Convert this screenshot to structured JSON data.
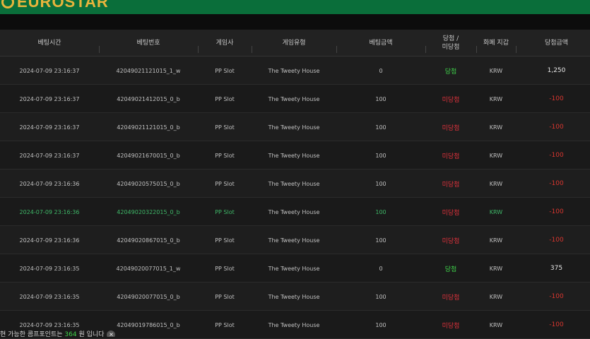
{
  "brand": {
    "logo_text": "EUROSTAR"
  },
  "nav": {
    "items": [
      "",
      "",
      "",
      "",
      "",
      "",
      "",
      "",
      "",
      ""
    ]
  },
  "table": {
    "headers": {
      "bet_time": "베팅시간",
      "bet_no": "베팅번호",
      "provider": "게임사",
      "game_type": "게임유형",
      "bet_amount": "베팅금액",
      "result_top": "당첨 /",
      "result_bottom": "미당첨",
      "currency": "화폐 지갑",
      "payout": "당첨금액"
    },
    "rows": [
      {
        "time": "2024-07-09 23:16:37",
        "no": "42049021121015_1_w",
        "provider": "PP Slot",
        "game": "The Tweety House",
        "amount": "0",
        "result": "당첨",
        "currency": "KRW",
        "payout": "1,250"
      },
      {
        "time": "2024-07-09 23:16:37",
        "no": "42049021412015_0_b",
        "provider": "PP Slot",
        "game": "The Tweety House",
        "amount": "100",
        "result": "미당첨",
        "currency": "KRW",
        "payout": "-100"
      },
      {
        "time": "2024-07-09 23:16:37",
        "no": "42049021121015_0_b",
        "provider": "PP Slot",
        "game": "The Tweety House",
        "amount": "100",
        "result": "미당첨",
        "currency": "KRW",
        "payout": "-100"
      },
      {
        "time": "2024-07-09 23:16:37",
        "no": "42049021670015_0_b",
        "provider": "PP Slot",
        "game": "The Tweety House",
        "amount": "100",
        "result": "미당첨",
        "currency": "KRW",
        "payout": "-100"
      },
      {
        "time": "2024-07-09 23:16:36",
        "no": "42049020575015_0_b",
        "provider": "PP Slot",
        "game": "The Tweety House",
        "amount": "100",
        "result": "미당첨",
        "currency": "KRW",
        "payout": "-100"
      },
      {
        "time": "2024-07-09 23:16:36",
        "no": "42049020322015_0_b",
        "provider": "PP Slot",
        "game": "The Tweety House",
        "amount": "100",
        "result": "미당첨",
        "currency": "KRW",
        "payout": "-100"
      },
      {
        "time": "2024-07-09 23:16:36",
        "no": "42049020867015_0_b",
        "provider": "PP Slot",
        "game": "The Tweety House",
        "amount": "100",
        "result": "미당첨",
        "currency": "KRW",
        "payout": "-100"
      },
      {
        "time": "2024-07-09 23:16:35",
        "no": "42049020077015_1_w",
        "provider": "PP Slot",
        "game": "The Tweety House",
        "amount": "0",
        "result": "당첨",
        "currency": "KRW",
        "payout": "375"
      },
      {
        "time": "2024-07-09 23:16:35",
        "no": "42049020077015_0_b",
        "provider": "PP Slot",
        "game": "The Tweety House",
        "amount": "100",
        "result": "미당첨",
        "currency": "KRW",
        "payout": "-100"
      },
      {
        "time": "2024-07-09 23:16:35",
        "no": "42049019786015_0_b",
        "provider": "PP Slot",
        "game": "The Tweety House",
        "amount": "100",
        "result": "미당첨",
        "currency": "KRW",
        "payout": "-100"
      }
    ]
  },
  "footer": {
    "prefix": "현 가능한 콤프포인트는 ",
    "count": "364",
    "suffix": " 원 입니다",
    "close_label": "×"
  },
  "colors": {
    "header_green": "#0a6e3a",
    "win": "#3fd34a",
    "lose": "#e0323c",
    "highlight_text": "#3fb868"
  }
}
